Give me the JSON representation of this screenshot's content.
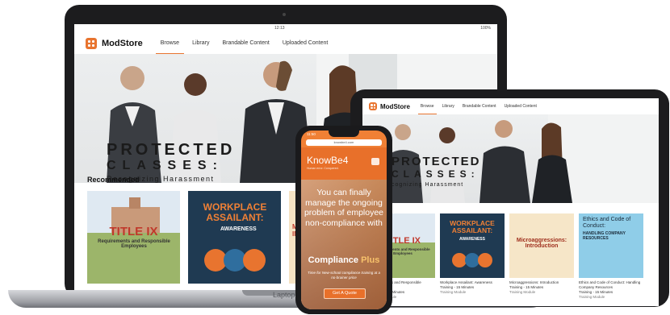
{
  "laptop": {
    "status_time": "12:13",
    "battery": "100%",
    "brand_label": "Laptop",
    "app": {
      "brand": "ModStore",
      "tabs": [
        "Browse",
        "Library",
        "Brandable Content",
        "Uploaded Content"
      ],
      "active_tab": "Browse",
      "hero_title_line1": "PROTECTED",
      "hero_title_line2": "CLASSES:",
      "hero_title_line3": "Recognizing Harassment",
      "recommended_heading": "Recommended",
      "cards": [
        {
          "title": "TITLE IX",
          "subtitle": "Requirements and Responsible Employees"
        },
        {
          "title": "WORKPLACE ASSAILANT:",
          "subtitle": "AWARENESS"
        },
        {
          "title": "M IN",
          "subtitle": ""
        }
      ]
    }
  },
  "tablet": {
    "app": {
      "brand": "ModStore",
      "tabs": [
        "Browse",
        "Library",
        "Brandable Content",
        "Uploaded Content"
      ],
      "hero_title_line1": "PROTECTED",
      "hero_title_line2": "CLASSES:",
      "hero_title_line3": "cognizing Harassment",
      "recommended_heading": "ended",
      "cards": [
        {
          "art_title": "TITLE IX",
          "art_sub": "Requirements and Responsible Employees",
          "caption": "Requirements and Responsible Employees",
          "meta": "Training - 15 Minutes",
          "type": "Training Module"
        },
        {
          "art_title": "WORKPLACE ASSAILANT:",
          "art_sub": "AWARENESS",
          "caption": "Workplace Assailant: Awareness",
          "meta": "Training - 15 Minutes",
          "type": "Training Module"
        },
        {
          "art_title": "Microaggressions: Introduction",
          "art_sub": "",
          "caption": "Microaggressions: Introduction",
          "meta": "Training - 15 Minutes",
          "type": "Training Module"
        },
        {
          "art_title": "Ethics and Code of Conduct:",
          "art_sub": "HANDLING COMPANY RESOURCES",
          "caption": "Ethics and Code of Conduct: Handling Company Resources",
          "meta": "Training - 15 Minutes",
          "type": "Training Module"
        }
      ]
    }
  },
  "phone": {
    "status_time": "11:50",
    "url": "knowbe4.com",
    "logo": "KnowBe4",
    "logo_sub": "Human error. Conquered.",
    "headline": "You can finally manage the ongoing problem of employee non-compliance with",
    "product_prefix": "Compliance",
    "product_accent": "Plus",
    "small_text": "Time for New-school compliance training at a no-brainer price",
    "cta": "Get A Quote"
  },
  "colors": {
    "accent": "#e8742f",
    "navy": "#1f3a52",
    "phone_orange": "#f08035"
  }
}
